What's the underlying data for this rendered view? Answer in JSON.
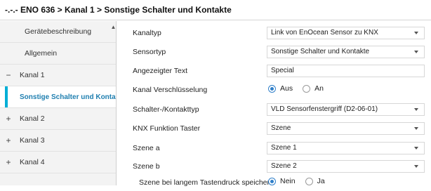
{
  "breadcrumb": "-.-.- ENO 636 > Kanal 1 > Sonstige Schalter und Kontakte",
  "sidebar": {
    "items": [
      {
        "label": "Gerätebeschreibung",
        "symbol": ""
      },
      {
        "label": "Allgemein",
        "symbol": ""
      },
      {
        "label": "Kanal 1",
        "symbol": "−"
      },
      {
        "label": "Sonstige Schalter und Konta...",
        "symbol": ""
      },
      {
        "label": "Kanal 2",
        "symbol": "+"
      },
      {
        "label": "Kanal 3",
        "symbol": "+"
      },
      {
        "label": "Kanal 4",
        "symbol": "+"
      }
    ]
  },
  "params": [
    {
      "label": "Kanaltyp",
      "type": "select",
      "value": "Link von EnOcean Sensor zu KNX"
    },
    {
      "label": "Sensortyp",
      "type": "select",
      "value": "Sonstige Schalter und Kontakte"
    },
    {
      "label": "Angezeigter Text",
      "type": "text",
      "value": "Special"
    },
    {
      "label": "Kanal Verschlüsselung",
      "type": "radio",
      "options": [
        "Aus",
        "An"
      ],
      "selected": "Aus"
    },
    {
      "label": "Schalter-/Kontakttyp",
      "type": "select",
      "value": "VLD Sensorfenstergriff (D2-06-01)"
    },
    {
      "label": "KNX Funktion Taster",
      "type": "select",
      "value": "Szene"
    },
    {
      "label": "Szene a",
      "type": "select",
      "value": "Szene 1"
    },
    {
      "label": "Szene b",
      "type": "select",
      "value": "Szene 2"
    },
    {
      "label": "Szene bei langem Tastendruck speichern",
      "type": "radio",
      "options": [
        "Nein",
        "Ja"
      ],
      "selected": "Nein"
    }
  ],
  "icons": {
    "scroll_up": "chevron-up-icon",
    "dropdown": "chevron-down-icon"
  },
  "colors": {
    "selected_accent": "#00aed6",
    "selected_text": "#1f7fb0",
    "radio_on": "#2f7fc9"
  }
}
